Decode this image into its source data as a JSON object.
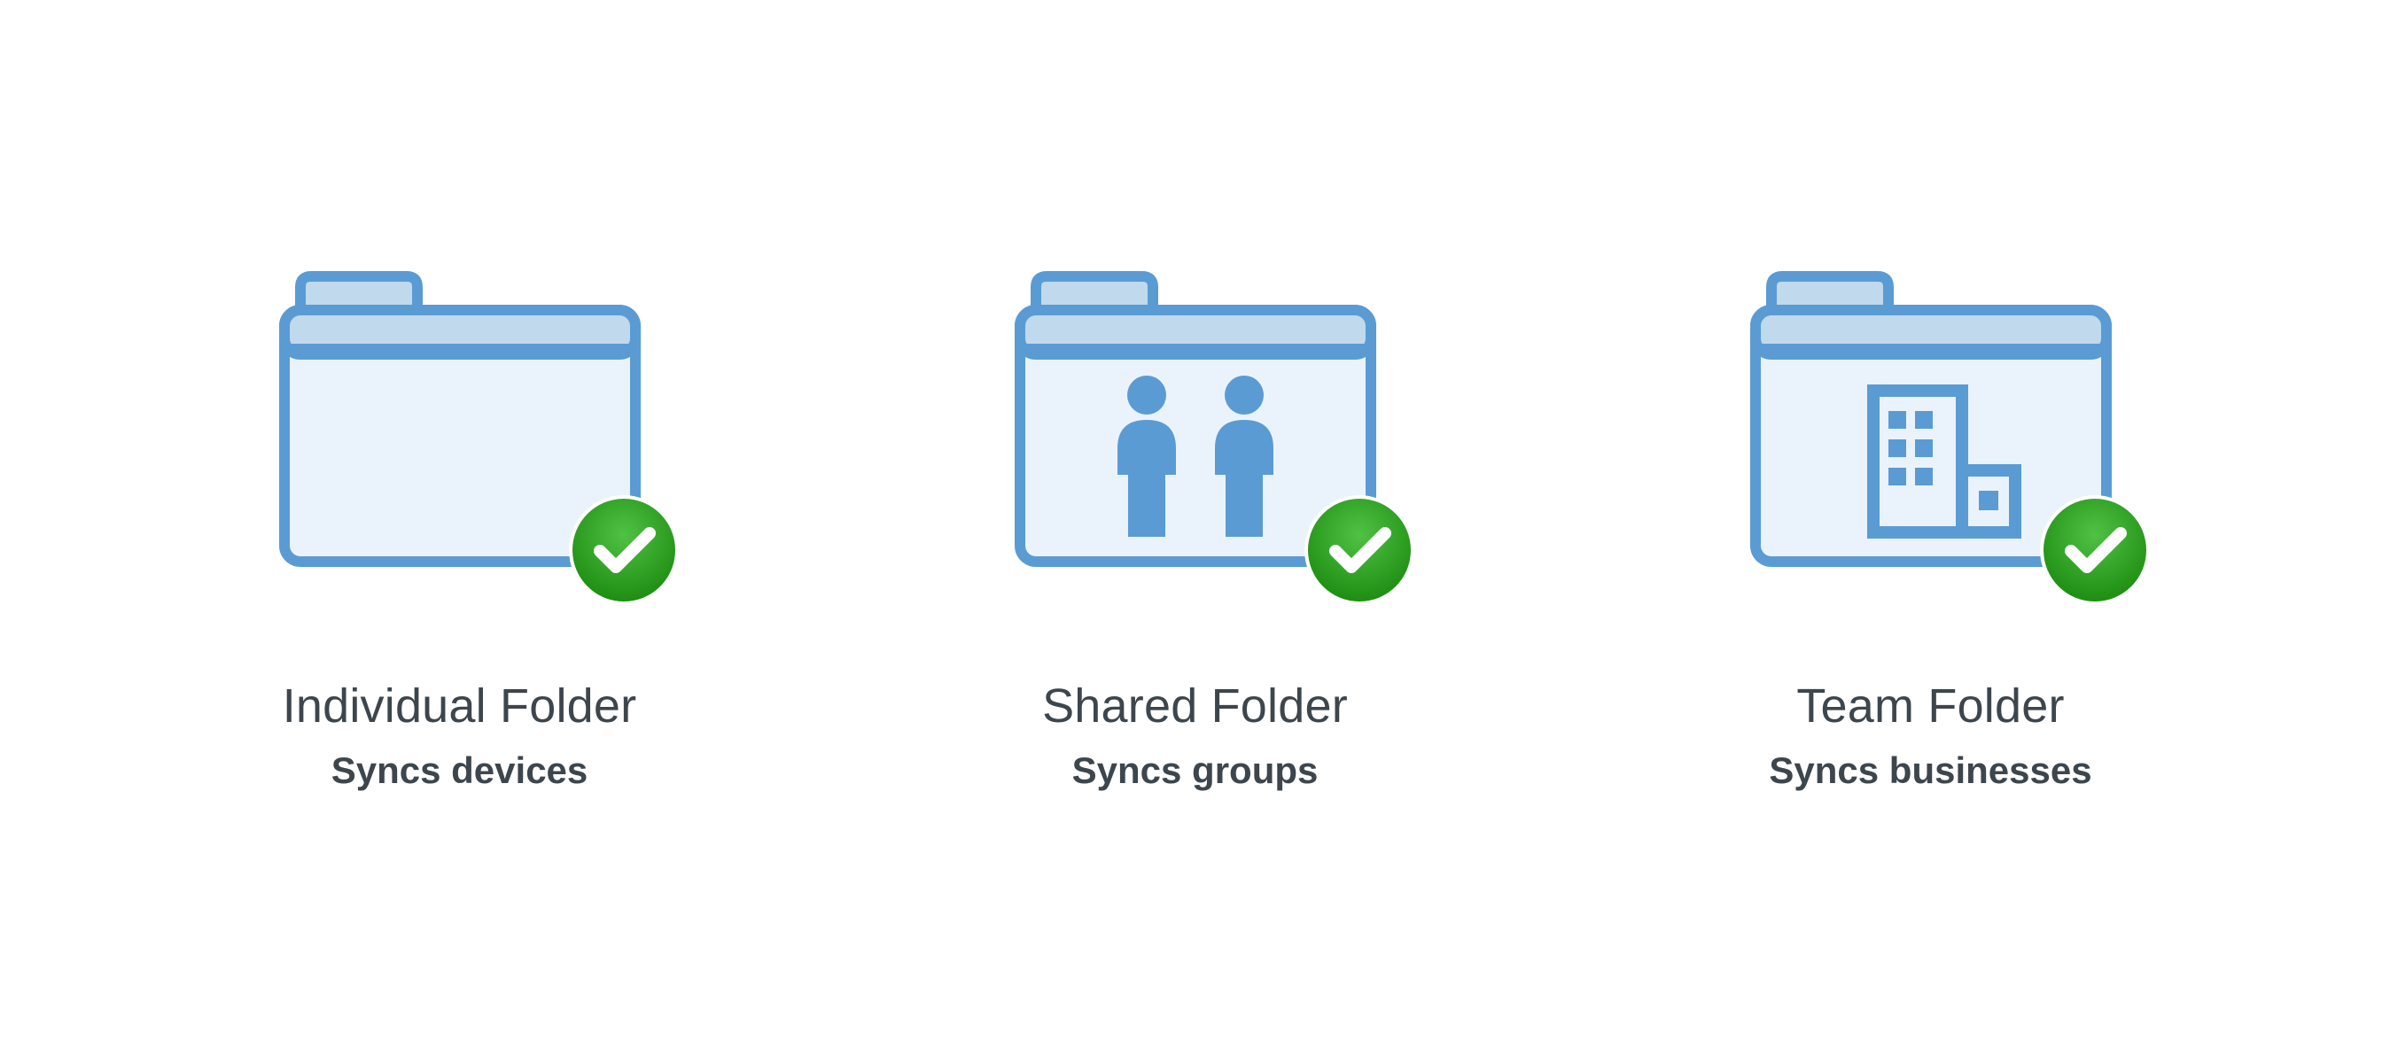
{
  "colors": {
    "folder_stroke": "#5a9bd4",
    "folder_tab_fill": "#c0d9ed",
    "folder_body_fill": "#eaf3fb",
    "inner_icon_fill": "#5a9bd4",
    "badge_green": "#2a9b1f",
    "badge_gradient_top": "#4fc143",
    "text": "#3d464d"
  },
  "cards": [
    {
      "icon": "folder-individual",
      "title": "Individual Folder",
      "subtitle": "Syncs devices"
    },
    {
      "icon": "folder-shared",
      "title": "Shared Folder",
      "subtitle": "Syncs groups"
    },
    {
      "icon": "folder-team",
      "title": "Team Folder",
      "subtitle": "Syncs businesses"
    }
  ]
}
